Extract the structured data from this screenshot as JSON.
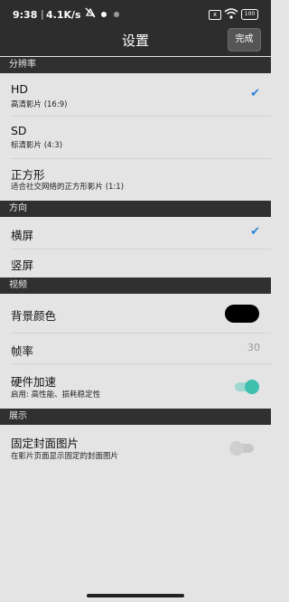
{
  "status_bar": {
    "time": "9:38",
    "separator": "|",
    "net_speed": "4.1K/s",
    "battery": "100",
    "sim_label": "x"
  },
  "header": {
    "title": "设置",
    "done_label": "完成"
  },
  "sections": {
    "resolution": {
      "title": "分辨率",
      "options": [
        {
          "label": "HD",
          "sub": "高清影片 (16:9)",
          "selected": true
        },
        {
          "label": "SD",
          "sub": "标清影片 (4:3)",
          "selected": false
        },
        {
          "label": "正方形",
          "sub": "适合社交网络的正方形影片 (1:1)",
          "selected": false
        }
      ]
    },
    "orientation": {
      "title": "方向",
      "options": [
        {
          "label": "横屏",
          "selected": true
        },
        {
          "label": "竖屏",
          "selected": false
        }
      ]
    },
    "video": {
      "title": "视频",
      "background_color_label": "背景颜色",
      "background_color_value": "#000000",
      "frame_rate_label": "帧率",
      "frame_rate_value": "30",
      "hw_accel_label": "硬件加速",
      "hw_accel_sub": "启用: 高性能、损耗稳定性",
      "hw_accel_on": true
    },
    "display": {
      "title": "展示",
      "fixed_cover_label": "固定封面图片",
      "fixed_cover_sub": "在影片页面显示固定的封面图片",
      "fixed_cover_on": false
    }
  },
  "colors": {
    "accent_check": "#2d82d8",
    "toggle_on": "#3fbfae",
    "header_bg": "#2d2d2d",
    "section_bg": "#303030",
    "content_bg": "#e4e4e4"
  },
  "icons": [
    "dnd-icon",
    "notification-dot-icon",
    "sim-icon",
    "wifi-icon",
    "battery-icon",
    "check-icon"
  ]
}
